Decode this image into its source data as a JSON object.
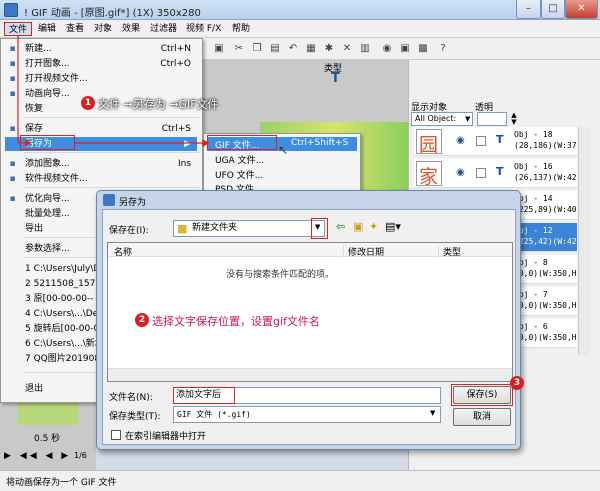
{
  "window": {
    "title": "! GIF 动画 - [原图.gif*] (1X) 350x280",
    "min": "–",
    "max": "□",
    "close": "✕"
  },
  "menubar": [
    "文件",
    "编辑",
    "查看",
    "对象",
    "效果",
    "过滤器",
    "视频 F/X",
    "帮助"
  ],
  "file_menu": [
    {
      "label": "新建...",
      "shortcut": "Ctrl+N",
      "icon": "new-file-icon"
    },
    {
      "label": "打开图象...",
      "shortcut": "Ctrl+O",
      "icon": "open-folder-icon"
    },
    {
      "label": "打开视频文件...",
      "shortcut": "",
      "icon": "video-icon"
    },
    {
      "label": "动画向导...",
      "shortcut": "",
      "icon": "wizard-icon"
    },
    {
      "label": "恢复",
      "shortcut": "",
      "icon": ""
    },
    {
      "label": "保存",
      "shortcut": "Ctrl+S",
      "icon": "save-icon"
    },
    {
      "label": "另存为",
      "shortcut": "▶",
      "icon": ""
    },
    {
      "label": "添加图象...",
      "shortcut": "Ins",
      "icon": "add-image-icon"
    },
    {
      "label": "软件视频文件...",
      "shortcut": "",
      "icon": "video-add-icon"
    },
    {
      "label": "优化向导...",
      "shortcut": "",
      "icon": "optimize-icon"
    },
    {
      "label": "批量处理...",
      "shortcut": "",
      "icon": ""
    },
    {
      "label": "导出",
      "shortcut": "▶",
      "icon": ""
    },
    {
      "label": "参数选择...",
      "shortcut": "",
      "icon": ""
    },
    {
      "label": "1 C:\\Users\\July\\D",
      "shortcut": "",
      "icon": ""
    },
    {
      "label": "2 5211508_15785",
      "shortcut": "",
      "icon": ""
    },
    {
      "label": "3 原[00-00-00--",
      "shortcut": "",
      "icon": ""
    },
    {
      "label": "4 C:\\Users\\...\\De",
      "shortcut": "",
      "icon": ""
    },
    {
      "label": "5 旋转后[00-00-00",
      "shortcut": "",
      "icon": ""
    },
    {
      "label": "6 C:\\Users\\...\\新坟",
      "shortcut": "",
      "icon": ""
    },
    {
      "label": "7 QQ图片201908",
      "shortcut": "",
      "icon": ""
    },
    {
      "label": "退出",
      "shortcut": "",
      "icon": ""
    }
  ],
  "submenu": [
    {
      "label": "GIF 文件...",
      "shortcut": "Ctrl+Shift+S"
    },
    {
      "label": "UGA 文件...",
      "shortcut": ""
    },
    {
      "label": "UFO 文件...",
      "shortcut": ""
    },
    {
      "label": "PSD 文件...",
      "shortcut": ""
    }
  ],
  "right_panel": {
    "type_label": "类型",
    "show_objects_label": "显示对象",
    "opacity_label": "透明",
    "object_filter": "All Object:",
    "objects": [
      {
        "glyph": "园",
        "t": "T",
        "line1": "Obj - 18",
        "line2": "(28,186)(W:37,",
        "selected": false
      },
      {
        "glyph": "家",
        "t": "T",
        "line1": "Obj - 16",
        "line2": "(26,137)(W:42,",
        "selected": false
      },
      {
        "glyph": "",
        "t": "",
        "line1": "Obj - 14",
        "line2": "(225,89)(W:40,H",
        "selected": false
      },
      {
        "glyph": "",
        "t": "",
        "line1": "Obj - 12",
        "line2": "(225,42)(W:42,",
        "selected": true
      },
      {
        "glyph": "",
        "t": "",
        "line1": "Obj - 8",
        "line2": "(0,0)(W:350,H:",
        "selected": false
      },
      {
        "glyph": "",
        "t": "",
        "line1": "Obj - 7",
        "line2": "(0,0)(W:350,H:",
        "selected": false
      },
      {
        "glyph": "",
        "t": "",
        "line1": "Obj - 6",
        "line2": "(0,0)(W:350,H:",
        "selected": false
      }
    ]
  },
  "timeline": {
    "duration": "0.5 秒",
    "frame": "1/6"
  },
  "dialog": {
    "title": "另存为",
    "save_in_label": "保存在(I):",
    "save_in_value": "新建文件夹",
    "col_name": "名称",
    "col_date": "修改日期",
    "col_type": "类型",
    "empty_text": "没有与搜索条件匹配的项。",
    "filename_label": "文件名(N):",
    "filename_value": "添加文字后",
    "filetype_label": "保存类型(T):",
    "filetype_value": "GIF 文件 (*.gif)",
    "save_button": "保存(S)",
    "cancel_button": "取消",
    "checkbox_label": "在索引编辑器中打开"
  },
  "annotations": {
    "step1": "文件 →另存为 →GIF文件",
    "step2": "选择文字保存位置，设置gif文件名",
    "n1": "1",
    "n2": "2",
    "n3": "3"
  },
  "status": "将动画保存为一个 GIF 文件"
}
